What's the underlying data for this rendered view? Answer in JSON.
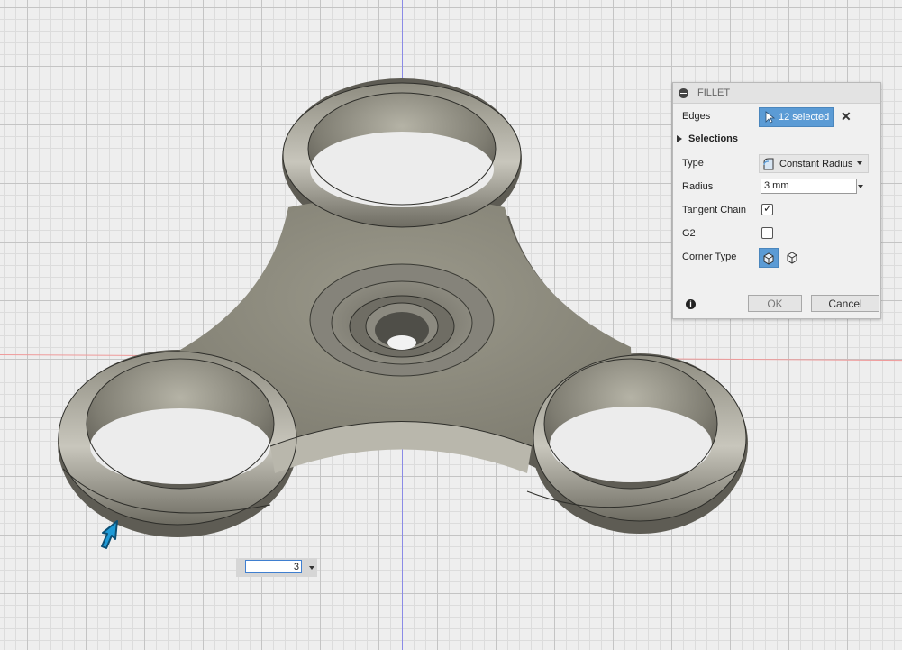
{
  "dialog": {
    "title": "FILLET",
    "edges_label": "Edges",
    "edges_value": "12 selected",
    "clear_symbol": "✕",
    "selections_label": "Selections",
    "type_label": "Type",
    "type_value": "Constant Radius",
    "radius_label": "Radius",
    "radius_value": "3 mm",
    "tangent_chain_label": "Tangent Chain",
    "tangent_chain_checked": true,
    "g2_label": "G2",
    "g2_checked": false,
    "corner_type_label": "Corner Type",
    "ok_label": "OK",
    "cancel_label": "Cancel",
    "info_symbol": "i"
  },
  "viewport": {
    "value_input": "3",
    "accent_color": "#5b9bd5",
    "drag_arrow_color": "#1e9ad6",
    "model_color": "#8a8a7c"
  }
}
